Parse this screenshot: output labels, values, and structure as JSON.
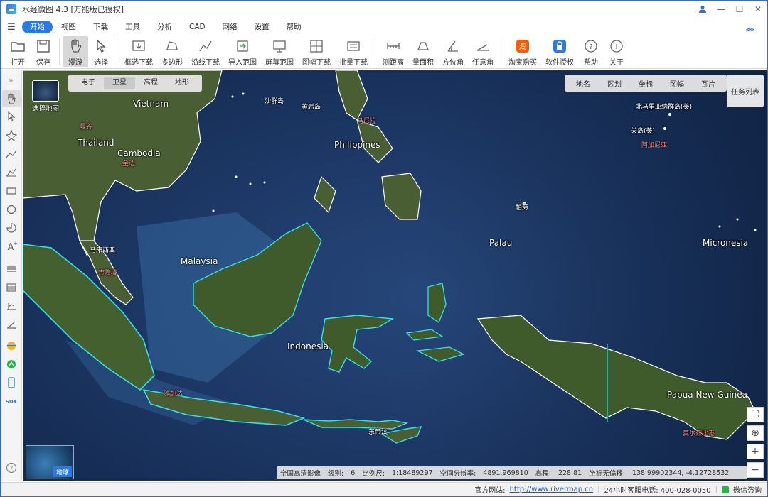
{
  "window": {
    "title": "水经微图 4.3 [万能版已授权]",
    "controls": {
      "user": "user-icon",
      "minimize": "—",
      "maximize": "☐",
      "close": "✕"
    }
  },
  "menu": {
    "items": [
      "开始",
      "视图",
      "下载",
      "工具",
      "分析",
      "CAD",
      "网络",
      "设置",
      "帮助"
    ],
    "active": "开始"
  },
  "ribbon": {
    "tools": [
      {
        "label": "打开",
        "icon": "folder-open-icon"
      },
      {
        "label": "保存",
        "icon": "save-icon"
      },
      {
        "label": "漫游",
        "icon": "hand-pan-icon",
        "selected": true
      },
      {
        "label": "选择",
        "icon": "pointer-select-icon"
      },
      {
        "label": "框选下载",
        "icon": "box-download-icon"
      },
      {
        "label": "多边形",
        "icon": "polygon-icon"
      },
      {
        "label": "沿线下载",
        "icon": "line-download-icon"
      },
      {
        "label": "导入范围",
        "icon": "import-range-icon"
      },
      {
        "label": "屏幕范围",
        "icon": "screen-range-icon"
      },
      {
        "label": "图幅下载",
        "icon": "sheet-download-icon"
      },
      {
        "label": "批量下载",
        "icon": "batch-download-icon"
      },
      {
        "label": "测距离",
        "icon": "measure-distance-icon"
      },
      {
        "label": "量面积",
        "icon": "measure-area-icon"
      },
      {
        "label": "方位角",
        "icon": "azimuth-icon"
      },
      {
        "label": "任意角",
        "icon": "any-angle-icon"
      },
      {
        "label": "淘宝购买",
        "icon": "taobao-icon"
      },
      {
        "label": "软件授权",
        "icon": "license-icon"
      },
      {
        "label": "帮助",
        "icon": "help-icon"
      },
      {
        "label": "关于",
        "icon": "about-icon"
      }
    ]
  },
  "map": {
    "basemap_button": "选择地图",
    "source_tabs": [
      "电子",
      "卫星",
      "高程",
      "地形"
    ],
    "active_source": "卫星",
    "layer_tabs": [
      "地名",
      "区划",
      "坐标",
      "图幅",
      "瓦片"
    ],
    "task_list": "任务列表",
    "globe_label": "地球",
    "place_labels": [
      {
        "text": "Vietnam",
        "cls": "big"
      },
      {
        "text": "Thailand",
        "cls": "big"
      },
      {
        "text": "Cambodia",
        "cls": "big"
      },
      {
        "text": "Philippines",
        "cls": "big"
      },
      {
        "text": "Malaysia",
        "cls": "big"
      },
      {
        "text": "Palau",
        "cls": "big"
      },
      {
        "text": "Indonesia",
        "cls": "big"
      },
      {
        "text": "Micronesia",
        "cls": "big"
      },
      {
        "text": "Papua New Guinea",
        "cls": "big"
      },
      {
        "text": "沙群岛",
        "cls": "small"
      },
      {
        "text": "黄岩岛",
        "cls": "small"
      },
      {
        "text": "北马里亚纳群岛(美)",
        "cls": "small"
      },
      {
        "text": "关岛(美)",
        "cls": "small"
      },
      {
        "text": "帕劳",
        "cls": "small"
      },
      {
        "text": "马来西亚",
        "cls": "small"
      },
      {
        "text": "东帝汶",
        "cls": "small"
      },
      {
        "text": "曼谷",
        "cls": "red"
      },
      {
        "text": "金边",
        "cls": "red"
      },
      {
        "text": "吉隆坡",
        "cls": "red"
      },
      {
        "text": "雅加达",
        "cls": "red"
      },
      {
        "text": "马尼拉",
        "cls": "red"
      },
      {
        "text": "阿加尼亚",
        "cls": "red"
      },
      {
        "text": "莫尔兹比港",
        "cls": "red"
      }
    ],
    "status": {
      "source": "全国高清影像",
      "level_label": "级别:",
      "level": "6",
      "scale_label": "比例尺:",
      "scale": "1:18489297",
      "resolution_label": "空间分辨率:",
      "resolution": "4891.969810",
      "elevation_label": "高程:",
      "elevation": "228.81",
      "coord_label": "坐标无偏移:",
      "coords": "138.99902344, -4.12728532"
    }
  },
  "bottom": {
    "site_label": "官方网站:",
    "site_url": "http://www.rivermap.cn",
    "hotline": "24小时客服电话: 400-028-0050",
    "wechat": "微信咨询"
  },
  "colors": {
    "accent": "#2b79e4",
    "ocean": "#1d3a68",
    "land": "#3e5a2c",
    "coast": "#35e0e8"
  }
}
